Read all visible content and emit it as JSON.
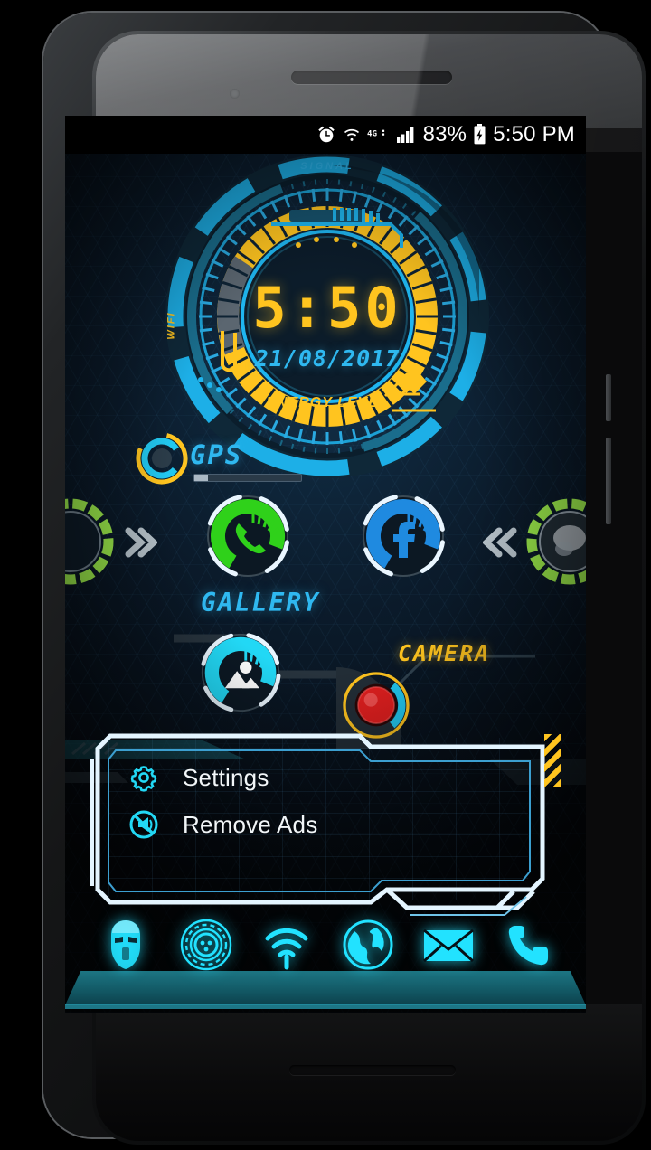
{
  "device": {
    "name": "android-phone",
    "bezel_color": "#1a1c1e"
  },
  "statusbar": {
    "alarm_icon": "alarm-icon",
    "wifi_icon": "wifi-icon",
    "network_label": "4G",
    "signal_icon": "cellular-signal-icon",
    "battery_percent": "83%",
    "battery_icon": "battery-charging-icon",
    "clock": "5:50 PM"
  },
  "clock_widget": {
    "time": "5:50",
    "date": "21/08/2017",
    "label_signal": "SIGNAL",
    "label_wifi": "WIFI",
    "label_energy": "ENERGY LEVEL",
    "ring_color_outer": "#1fb6f0",
    "ring_color_inner": "#ffc41f"
  },
  "gps_widget": {
    "label": "GPS",
    "icon": "gps-ring-icon",
    "progress": "13%"
  },
  "apps": [
    {
      "name": "edge-left-app",
      "label": "",
      "icon": "partial-circle-icon",
      "ring_color": "#9ae84a"
    },
    {
      "name": "nav-next-arrow",
      "label": "",
      "icon": "chevron-right-icon",
      "ring_color": "#b7c3cb"
    },
    {
      "name": "phone-app",
      "label": "",
      "icon": "phone-handset-icon",
      "ring_color": "#2fd11a"
    },
    {
      "name": "facebook-app",
      "label": "",
      "icon": "facebook-f-icon",
      "ring_color": "#1f8ae0"
    },
    {
      "name": "nav-prev-arrow",
      "label": "",
      "icon": "chevron-left-icon",
      "ring_color": "#b7c3cb"
    },
    {
      "name": "edge-right-app",
      "label": "",
      "icon": "photo-thumb-icon",
      "ring_color": "#9ae84a"
    }
  ],
  "labels": {
    "gallery": "GALLERY",
    "camera": "CAMERA"
  },
  "gallery_app": {
    "name": "gallery-app",
    "icon": "image-mountain-icon",
    "ring_color": "#22e2ff"
  },
  "camera_app": {
    "name": "camera-app",
    "icon": "camera-lens-icon",
    "ring_color": "#ffc41f",
    "lens_color": "#e01f1f"
  },
  "popup": {
    "name": "hud-context-menu",
    "border_color": "#cfeefc",
    "fill_color": "#102336",
    "items": [
      {
        "label": "Settings",
        "icon": "gear-icon"
      },
      {
        "label": "Remove Ads",
        "icon": "no-ads-icon"
      }
    ]
  },
  "dock": {
    "items": [
      {
        "label": "Iron Man",
        "icon": "ironman-mask-icon"
      },
      {
        "label": "App Drawer",
        "icon": "app-drawer-icon"
      },
      {
        "label": "WiFi",
        "icon": "wifi-icon"
      },
      {
        "label": "Browser",
        "icon": "globe-icon"
      },
      {
        "label": "Email",
        "icon": "envelope-icon"
      },
      {
        "label": "Phone",
        "icon": "phone-handset-icon"
      }
    ],
    "accent_color": "#22e2ff"
  }
}
